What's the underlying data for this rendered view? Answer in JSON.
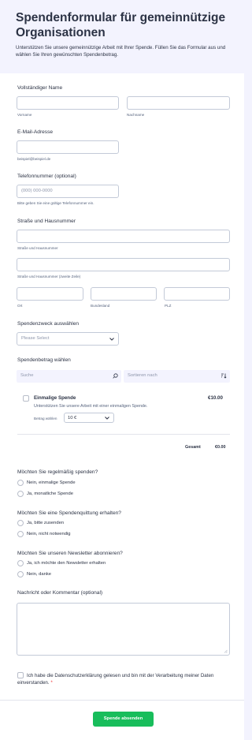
{
  "header": {
    "title": "Spendenformular für gemeinnützige Organisationen",
    "subtitle": "Unterstützen Sie unsere gemeinnützige Arbeit mit Ihrer Spende. Füllen Sie das Formular aus und wählen Sie Ihren gewünschten Spendenbetrag."
  },
  "name": {
    "label": "Vollständiger Name",
    "first_sub": "Vorname",
    "last_sub": "Nachname"
  },
  "email": {
    "label": "E-Mail-Adresse",
    "sub": "beispiel@beispiel.de"
  },
  "phone": {
    "label": "Telefonnummer (optional)",
    "placeholder": "(000) 000-0000",
    "sub": "Bitte geben Sie eine gültige Telefonnummer ein."
  },
  "address": {
    "label": "Straße und Hausnummer",
    "street_sub": "Straße und Hausnummer",
    "street2_sub": "Straße und Hausnummer (zweite Zeile)",
    "city_sub": "Ort",
    "state_sub": "Bundesland",
    "zip_sub": "PLZ"
  },
  "purpose": {
    "label": "Spendenzweck auswählen",
    "selected": "Please Select"
  },
  "amount": {
    "label": "Spendenbetrag wählen",
    "search_placeholder": "Suche",
    "sort_placeholder": "Sortieren nach",
    "product_name": "Einmalige Spende",
    "product_desc": "Unterstützen Sie unsere Arbeit mit einer einmaligen Spende.",
    "product_price": "€10.00",
    "select_label": "Betrag wählen",
    "select_value": "10 €",
    "total_label": "Gesamt",
    "total_value": "€0.00"
  },
  "recurring": {
    "question": "Möchten Sie regelmäßig spenden?",
    "options": [
      "Nein, einmalige Spende",
      "Ja, monatliche Spende"
    ]
  },
  "receipt": {
    "question": "Möchten Sie eine Spendenquittung erhalten?",
    "options": [
      "Ja, bitte zusenden",
      "Nein, nicht notwendig"
    ]
  },
  "newsletter": {
    "question": "Möchten Sie unseren Newsletter abonnieren?",
    "options": [
      "Ja, ich möchte den Newsletter erhalten",
      "Nein, danke"
    ]
  },
  "message": {
    "label": "Nachricht oder Kommentar (optional)"
  },
  "consent": {
    "text": "Ich habe die Datenschutzerklärung gelesen und bin mit der Verarbeitung meiner Daten einverstanden.",
    "required_mark": "*"
  },
  "submit": {
    "label": "Spende absenden"
  },
  "colors": {
    "submit": "#18bd5b",
    "required": "#f23a3c",
    "background": "#f3f3fe"
  }
}
